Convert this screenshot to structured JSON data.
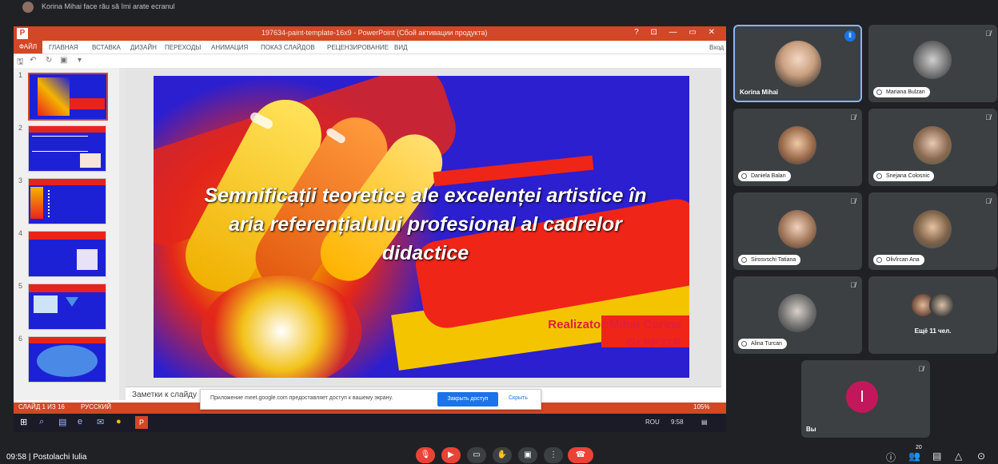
{
  "top_banner": {
    "text": "Korina Mihai face rău să îmi arate ecranul"
  },
  "ppt": {
    "logo": "P",
    "window_title": "197634-paint-template-16x9 - PowerPoint (Сбой активации продукта)",
    "window_controls": "? ⊡ — ▭ ✕",
    "file_tab": "ФАЙЛ",
    "ribbon_tabs": [
      "ГЛАВНАЯ",
      "ВСТАВКА",
      "ДИЗАЙН",
      "ПЕРЕХОДЫ",
      "АНИМАЦИЯ",
      "ПОКАЗ СЛАЙДОВ",
      "РЕЦЕНЗИРОВАНИЕ",
      "ВИД"
    ],
    "sign_in": "Вход",
    "thumbnail_numbers": [
      "1",
      "2",
      "3",
      "4",
      "5",
      "6"
    ],
    "notes_placeholder": "Заметки к слайду",
    "status_slide": "СЛАЙД 1 ИЗ 16",
    "status_lang": "РУССКИЙ",
    "zoom": "105%"
  },
  "slide": {
    "title": "Semnificații teoretice ale excelenței artistice în aria referențialului profesional al cadrelor didactice",
    "author_line1": "Realizator:Mihai Corina",
    "author_line2": "Gr.PP31R"
  },
  "share_banner": {
    "message": "Приложение meet.google.com предоставляет доступ к вашему экрану.",
    "stop_button": "Закрыть доступ",
    "hide_link": "Скрыть"
  },
  "taskbar": {
    "lang": "ROU",
    "time": "9:58"
  },
  "participants": [
    {
      "name": "Korina Mihai",
      "active": true
    },
    {
      "name": "Mariana Bulzan"
    },
    {
      "name": "Daniela Balan"
    },
    {
      "name": "Snejana Colosnic"
    },
    {
      "name": "Sirosvschi Tatiana"
    },
    {
      "name": "Olivîrcan Ana"
    },
    {
      "name": "Alina Turcan"
    },
    {
      "name": "Ещё 11 чел."
    },
    {
      "name": "Вы",
      "initial": "I"
    }
  ],
  "footer": {
    "time": "09:58",
    "separator": "|",
    "meeting_owner": "Postolachi Iulia",
    "people_count": "20"
  },
  "colors": {
    "meet_bg": "#202124",
    "tile_bg": "#3c4043",
    "ppt_accent": "#d24726",
    "slide_blue": "#2b1fd0",
    "end_call_red": "#ea4335",
    "own_avatar": "#c2185b"
  }
}
